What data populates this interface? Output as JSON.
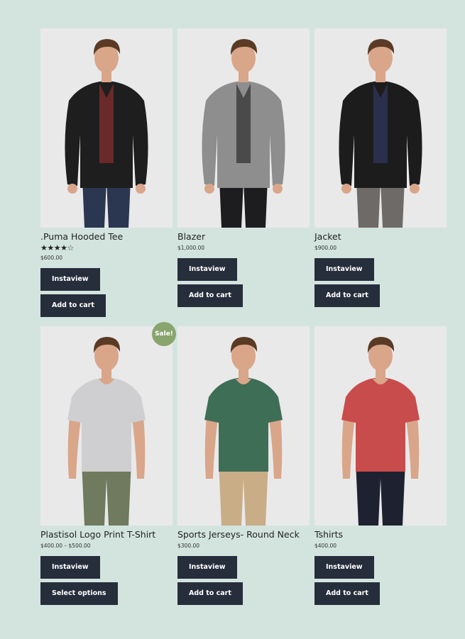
{
  "products": [
    {
      "title": ".Puma Hooded Tee",
      "rating": 4,
      "rating_max": 5,
      "price": "$600.00",
      "button1": "Instaview",
      "button2": "Add to cart",
      "sale": false,
      "top_color": "#1e1e1f",
      "under_color": "#6a2a2a",
      "pants_color": "#2b3650",
      "type": "hoodie"
    },
    {
      "title": "Blazer",
      "price": "$1,000.00",
      "button1": "Instaview",
      "button2": "Add to cart",
      "sale": false,
      "top_color": "#8e8e8e",
      "under_color": "#4a4a4a",
      "pants_color": "#1d1d20",
      "type": "blazer"
    },
    {
      "title": "Jacket",
      "price": "$900.00",
      "button1": "Instaview",
      "button2": "Add to cart",
      "sale": false,
      "top_color": "#1c1c1d",
      "under_color": "#2b2f4d",
      "pants_color": "#6d6a68",
      "type": "jacket"
    },
    {
      "title": "Plastisol Logo Print T-Shirt",
      "price": "$400.00 – $500.00",
      "button1": "Instaview",
      "button2": "Select options",
      "sale": true,
      "sale_label": "Sale!",
      "top_color": "#cfcfd1",
      "pants_color": "#6f7a5e",
      "type": "tshirt"
    },
    {
      "title": "Sports Jerseys- Round Neck",
      "price": "$300.00",
      "button1": "Instaview",
      "button2": "Add to cart",
      "sale": false,
      "top_color": "#3f6e57",
      "pants_color": "#c8ad86",
      "type": "tshirt"
    },
    {
      "title": "Tshirts",
      "price": "$400.00",
      "button1": "Instaview",
      "button2": "Add to cart",
      "sale": false,
      "top_color": "#c94c4c",
      "pants_color": "#1e2130",
      "type": "tshirt"
    }
  ],
  "skin_color": "#d9a68a",
  "hair_color": "#5a3a24"
}
